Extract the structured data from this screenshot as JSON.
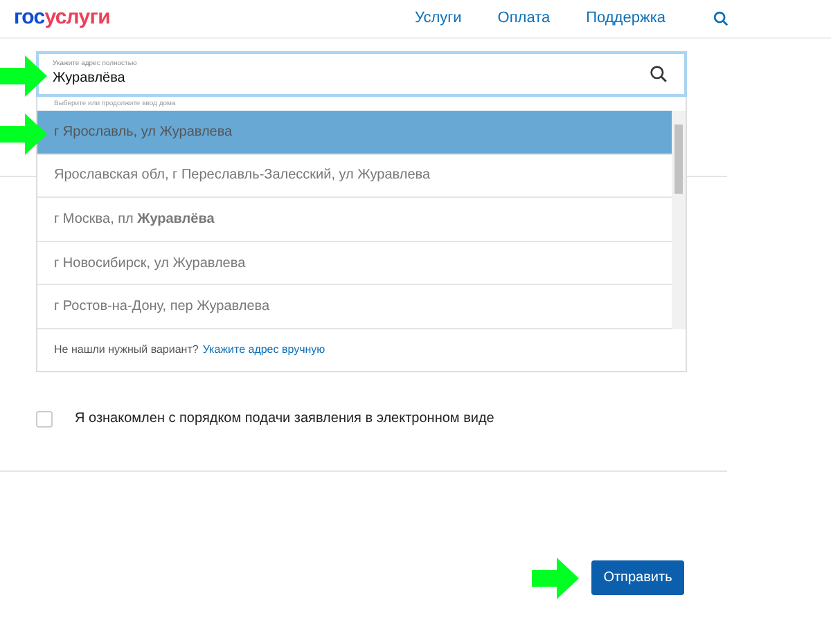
{
  "header": {
    "logo": {
      "prefix": "гос",
      "suffix": "услуги"
    },
    "nav": [
      {
        "label": "Услуги"
      },
      {
        "label": "Оплата"
      },
      {
        "label": "Поддержка"
      }
    ]
  },
  "address_field": {
    "label": "Укажите адрес полностью",
    "value": "Журавлёва"
  },
  "suggestions": {
    "hint": "Выберите или продолжите ввод дома",
    "items": [
      {
        "text": "г Ярославль, ул Журавлева",
        "selected": true
      },
      {
        "text": "Ярославская обл, г Переславль-Залесский, ул Журавлева",
        "selected": false
      },
      {
        "text": "г Москва, пл **Журавлёва**",
        "selected": false
      },
      {
        "text": "г Новосибирск, ул Журавлева",
        "selected": false
      },
      {
        "text": "г Ростов-на-Дону, пер Журавлева",
        "selected": false
      }
    ],
    "footer_text": "Не нашли нужный вариант?",
    "footer_link": "Укажите адрес вручную"
  },
  "agreement": {
    "label": "Я ознакомлен с порядком подачи заявления в электронном виде",
    "checked": false
  },
  "submit_button": "Отправить"
}
